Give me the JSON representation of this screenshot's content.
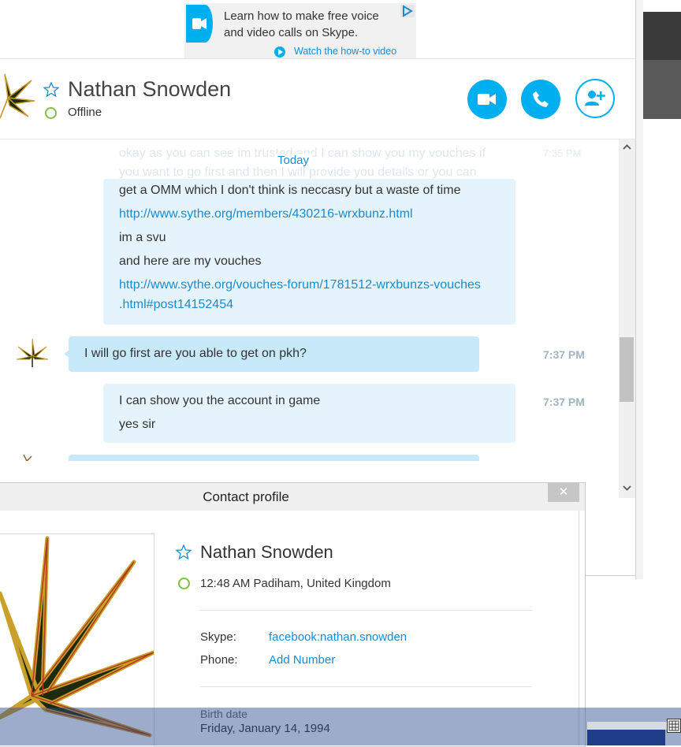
{
  "ad": {
    "line1": "Learn how to make free voice",
    "line2": "and video calls on Skype.",
    "link": "Watch the how-to video"
  },
  "contact": {
    "name": "Nathan Snowden",
    "status": "Offline"
  },
  "chat": {
    "faded_message": "okay as you can see im trusted and I can show you my vouches if you want to go first and then I will provide you details or you can",
    "faded_time": "7:35 PM",
    "date_separator": "Today",
    "messages": [
      {
        "text": "get a OMM which I don't think is neccasry but a waste of time"
      },
      {
        "text": "http://www.sythe.org/members/430216-wrxbunz.html",
        "link": true
      },
      {
        "text": "im a svu"
      },
      {
        "text": "and here are my vouches"
      },
      {
        "text": "http://www.sythe.org/vouches-forum/1781512-wrxbunzs-vouches",
        "link": true
      },
      {
        "text": ".html#post14152454",
        "link": true
      }
    ],
    "incoming": {
      "text": "I will go first are you able to get on pkh?",
      "time": "7:37 PM"
    },
    "outgoing": {
      "line1": "I can show you the account in game",
      "line2": "yes sir",
      "time": "7:37 PM"
    }
  },
  "profile": {
    "title": "Contact profile",
    "close": "✕",
    "name": "Nathan Snowden",
    "local_time": "12:48 AM Padiham, United Kingdom",
    "skype_label": "Skype:",
    "skype_value": "facebook:nathan.snowden",
    "phone_label": "Phone:",
    "phone_value": "Add Number",
    "birth_label": "Birth date",
    "birth_value": "Friday, January 14, 1994"
  },
  "icons": {
    "video": "video-camera-icon",
    "call": "phone-icon",
    "add": "add-contact-icon",
    "favorite": "star-icon"
  },
  "colors": {
    "accent": "#00aff0",
    "link": "#1a8bd2",
    "bubble_incoming": "#c7e9fa",
    "bubble_outgoing": "#e5f4fc",
    "online_ring": "#7cc242"
  }
}
